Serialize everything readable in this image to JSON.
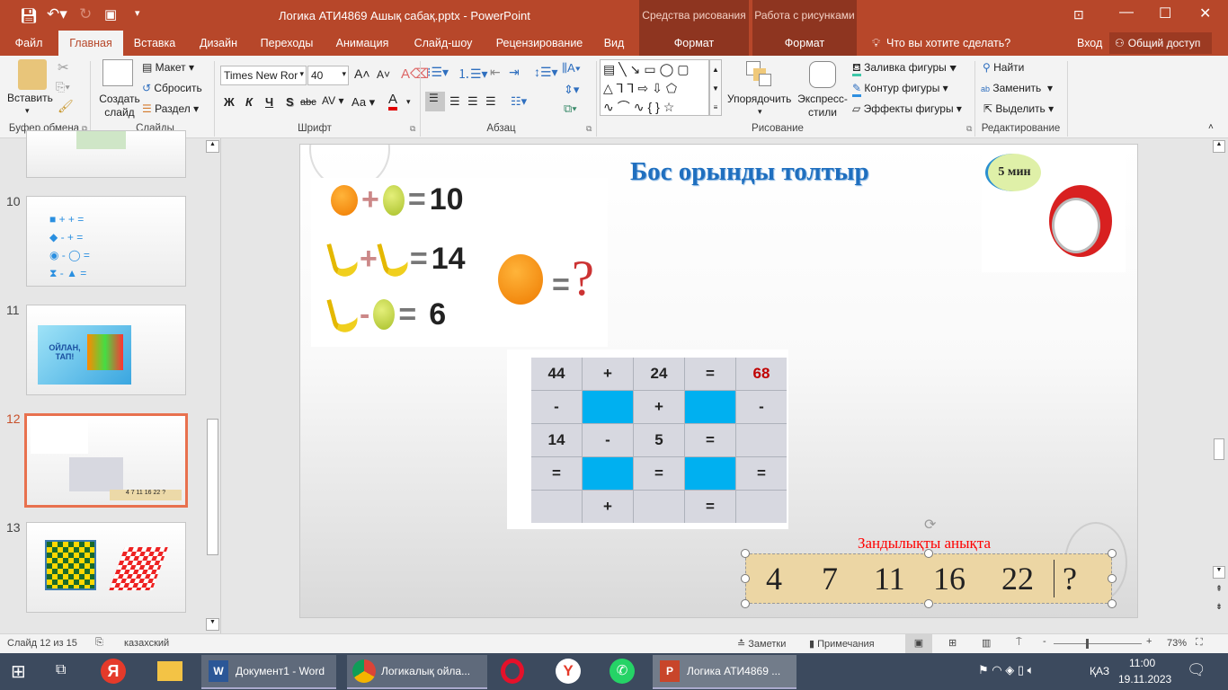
{
  "window": {
    "title": "Логика АТИ4869 Ашық сабақ.pptx - PowerPoint",
    "context_groups": [
      "Средства рисования",
      "Работа с рисунками"
    ]
  },
  "tabs": [
    "Файл",
    "Главная",
    "Вставка",
    "Дизайн",
    "Переходы",
    "Анимация",
    "Слайд-шоу",
    "Рецензирование",
    "Вид",
    "Формат",
    "Формат"
  ],
  "tell_me": "Что вы хотите сделать?",
  "signin": "Вход",
  "share": "Общий доступ",
  "ribbon": {
    "clipboard": {
      "paste": "Вставить",
      "label": "Буфер обмена"
    },
    "slides": {
      "new_slide": "Создать слайд",
      "layout": "Макет",
      "reset": "Сбросить",
      "section": "Раздел",
      "label": "Слайды"
    },
    "font": {
      "name": "Times New Ror",
      "size": "40",
      "bold": "Ж",
      "italic": "К",
      "underline": "Ч",
      "shadow": "S",
      "strike": "abc",
      "spacing": "AV",
      "case": "Аа",
      "color_letter": "A",
      "label": "Шрифт"
    },
    "paragraph": {
      "label": "Абзац"
    },
    "drawing": {
      "arrange": "Упорядочить",
      "quick_styles": "Экспресс-стили",
      "fill": "Заливка фигуры",
      "outline": "Контур фигуры",
      "effects": "Эффекты фигуры",
      "label": "Рисование"
    },
    "editing": {
      "find": "Найти",
      "replace": "Заменить",
      "select": "Выделить",
      "label": "Редактирование"
    }
  },
  "thumbnails": [
    {
      "num": "10"
    },
    {
      "num": "11",
      "text": "ОЙЛАН, ТАП!"
    },
    {
      "num": "12"
    },
    {
      "num": "13"
    }
  ],
  "slide": {
    "title": "Бос орынды толтыр",
    "timer": "5 мин",
    "equations": [
      {
        "op": "+",
        "result": "10"
      },
      {
        "op": "+",
        "result": "14"
      },
      {
        "op": "-",
        "result": "6"
      }
    ],
    "question_mark": "?",
    "grid": [
      [
        "44",
        "+",
        "24",
        "=",
        "68"
      ],
      [
        "-",
        "",
        "+",
        "",
        "-"
      ],
      [
        "14",
        "-",
        "5",
        "=",
        ""
      ],
      [
        "=",
        "",
        "=",
        "",
        "="
      ],
      [
        "",
        "+",
        "",
        "=",
        ""
      ]
    ],
    "blue_cells": [
      [
        1,
        1
      ],
      [
        1,
        3
      ],
      [
        3,
        1
      ],
      [
        3,
        3
      ]
    ],
    "sequence_label": "Зандылықты анықта",
    "sequence": [
      "4",
      "7",
      "11",
      "16",
      "22",
      "?"
    ],
    "colors": {
      "title": "#1f6fbf",
      "result": "#c00000",
      "label": "#ff0000",
      "blue": "#00b0f0"
    }
  },
  "status": {
    "slide": "Слайд 12 из 15",
    "language": "казахский",
    "notes": "Заметки",
    "comments": "Примечания",
    "zoom": "73%",
    "zoom_level": 0.73
  },
  "taskbar": {
    "apps": [
      "Документ1 - Word",
      "Логикалық ойла...",
      "Логика АТИ4869 ..."
    ],
    "lang": "ҚАЗ",
    "time": "11:00",
    "date": "19.11.2023"
  }
}
